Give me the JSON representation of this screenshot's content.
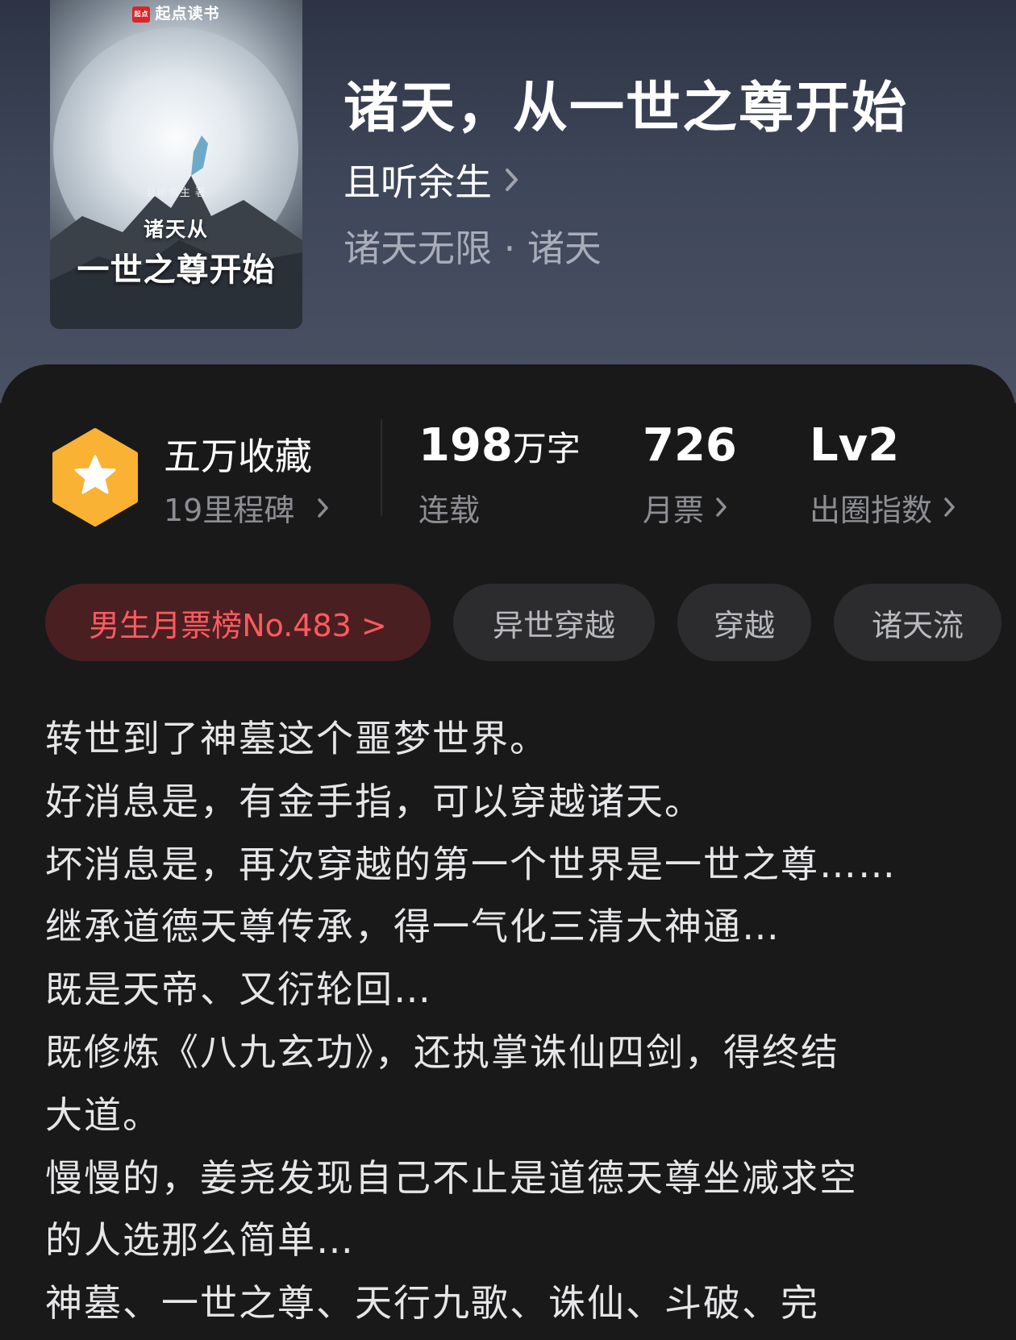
{
  "cover": {
    "brand": "起点读书",
    "brand_mark": "起点",
    "author": "且听余生 著",
    "title_line1": "诸天从",
    "title_line2": "一世之尊开始"
  },
  "book": {
    "title": "诸天，从一世之尊开始",
    "author": "且听余生",
    "genre": "诸天无限 · 诸天"
  },
  "stats": {
    "favorites": "五万收藏",
    "milestones": "19里程碑",
    "word_count": "198",
    "word_unit": "万字",
    "status": "连载",
    "monthly_votes": "726",
    "monthly_votes_label": "月票",
    "influence": "Lv2",
    "influence_label": "出圈指数"
  },
  "tags": {
    "rank": "男生月票榜No.483 >",
    "items": [
      "异世穿越",
      "穿越",
      "诸天流"
    ]
  },
  "description": [
    "转世到了神墓这个噩梦世界。",
    "好消息是，有金手指，可以穿越诸天。",
    "坏消息是，再次穿越的第一个世界是一世之尊……",
    "继承道德天尊传承，得一气化三清大神通…",
    "既是天帝、又衍轮回…",
    "既修炼《八九玄功》，还执掌诛仙四剑，得终结",
    "大道。",
    "慢慢的，姜尧发现自己不止是道德天尊坐减求空",
    "的人选那么简单…",
    "神墓、一世之尊、天行九歌、诛仙、斗破、完"
  ],
  "colors": {
    "badge": "#f9b233",
    "rank_text": "#ff5a5f",
    "rank_bg": "#4a1f22",
    "panel_bg": "#19191a"
  }
}
